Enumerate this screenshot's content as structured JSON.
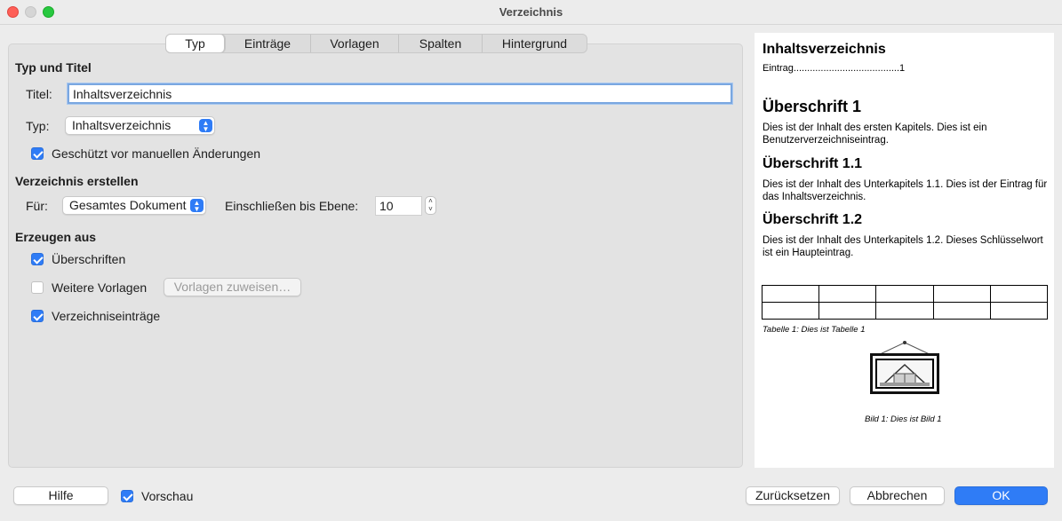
{
  "window": {
    "title": "Verzeichnis"
  },
  "tabs": [
    {
      "label": "Typ",
      "active": true
    },
    {
      "label": "Einträge",
      "active": false
    },
    {
      "label": "Vorlagen",
      "active": false
    },
    {
      "label": "Spalten",
      "active": false
    },
    {
      "label": "Hintergrund",
      "active": false
    }
  ],
  "type_section": {
    "heading": "Typ und Titel",
    "title_label": "Titel:",
    "title_value": "Inhaltsverzeichnis",
    "type_label": "Typ:",
    "type_value": "Inhaltsverzeichnis",
    "protected_label": "Geschützt vor manuellen Änderungen",
    "protected_checked": true
  },
  "create_section": {
    "heading": "Verzeichnis erstellen",
    "for_label": "Für:",
    "for_value": "Gesamtes Dokument",
    "level_label": "Einschließen bis Ebene:",
    "level_value": "10"
  },
  "generate_section": {
    "heading": "Erzeugen aus",
    "headings_label": "Überschriften",
    "headings_checked": true,
    "more_styles_label": "Weitere Vorlagen",
    "more_styles_checked": false,
    "assign_styles_label": "Vorlagen zuweisen…",
    "index_entries_label": "Verzeichniseinträge",
    "index_entries_checked": true
  },
  "preview": {
    "toc_title": "Inhaltsverzeichnis",
    "toc_entry": "Eintrag.......................................1",
    "h1": "Überschrift 1",
    "p1": "Dies ist der Inhalt des ersten Kapitels. Dies ist ein Benutzerverzeichniseintrag.",
    "h11": "Überschrift 1.1",
    "p11": "Dies ist der Inhalt des Unterkapitels 1.1. Dies ist der Eintrag für das Inhaltsverzeichnis.",
    "h12": "Überschrift 1.2",
    "p12": "Dies ist der Inhalt des Unterkapitels 1.2. Dieses Schlüsselwort ist ein Haupteintrag.",
    "table_caption": "Tabelle 1: Dies ist Tabelle 1",
    "image_caption": "Bild 1: Dies ist Bild 1"
  },
  "footer": {
    "help_label": "Hilfe",
    "preview_label": "Vorschau",
    "preview_checked": true,
    "reset_label": "Zurücksetzen",
    "cancel_label": "Abbrechen",
    "ok_label": "OK"
  },
  "colors": {
    "accent": "#2f7cf6",
    "close": "#fe5f57",
    "maximize": "#28c840"
  }
}
